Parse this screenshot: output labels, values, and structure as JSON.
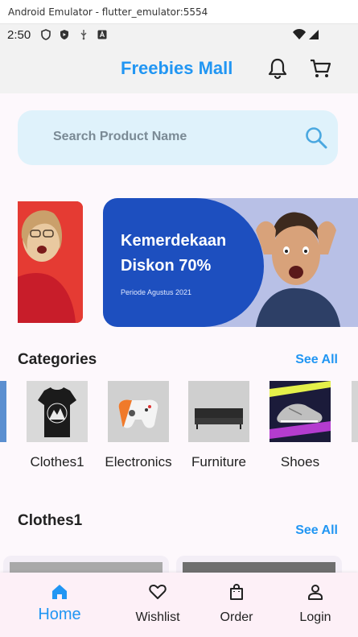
{
  "window": {
    "title": "Android Emulator - flutter_emulator:5554"
  },
  "status_bar": {
    "time": "2:50"
  },
  "app_bar": {
    "title": "Freebies Mall",
    "icons": [
      "bell-icon",
      "cart-icon"
    ]
  },
  "search": {
    "placeholder": "Search Product Name",
    "icon": "search-icon"
  },
  "banners": [
    {
      "line1": "",
      "line2": "",
      "line3": ""
    },
    {
      "line1": "Kemerdekaan",
      "line2": "Diskon 70%",
      "line3": "Periode Agustus 2021"
    }
  ],
  "categories_section": {
    "title": "Categories",
    "see_all": "See All",
    "items": [
      {
        "label": "Clothes1"
      },
      {
        "label": "Electronics"
      },
      {
        "label": "Furniture"
      },
      {
        "label": "Shoes"
      }
    ]
  },
  "products_section": {
    "title": "Clothes1",
    "see_all": "See All"
  },
  "bottom_nav": {
    "items": [
      {
        "label": "Home",
        "icon": "home-icon",
        "active": true
      },
      {
        "label": "Wishlist",
        "icon": "heart-icon",
        "active": false
      },
      {
        "label": "Order",
        "icon": "bag-icon",
        "active": false
      },
      {
        "label": "Login",
        "icon": "person-icon",
        "active": false
      }
    ]
  },
  "colors": {
    "accent": "#2196f3",
    "search_bg": "#dff2fb",
    "banner_blue": "#1d4fbf",
    "banner_red": "#e53b33"
  }
}
